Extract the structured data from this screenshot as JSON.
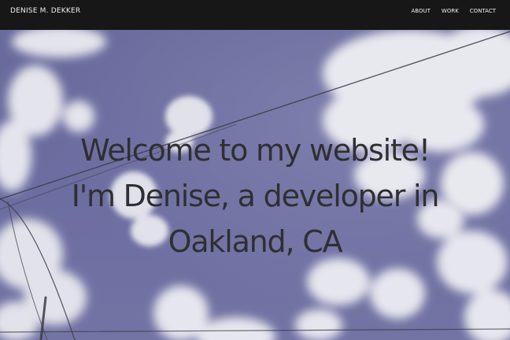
{
  "site": {
    "brand": "DENISE M. DEKKER"
  },
  "nav": {
    "items": [
      {
        "label": "ABOUT"
      },
      {
        "label": "WORK"
      },
      {
        "label": "CONTACT"
      }
    ]
  },
  "hero": {
    "heading_lines": [
      "Welcome to my website!",
      "I'm Denise, a developer in",
      "Oakland, CA"
    ],
    "background": "cloudy-sky-photo-with-power-lines"
  },
  "colors": {
    "navbar": "#171717",
    "nav_text": "#f0f0f0",
    "sky": "#6b6c9f",
    "cloud": "#e9e9ee",
    "heading_text": "#2f2f33"
  }
}
